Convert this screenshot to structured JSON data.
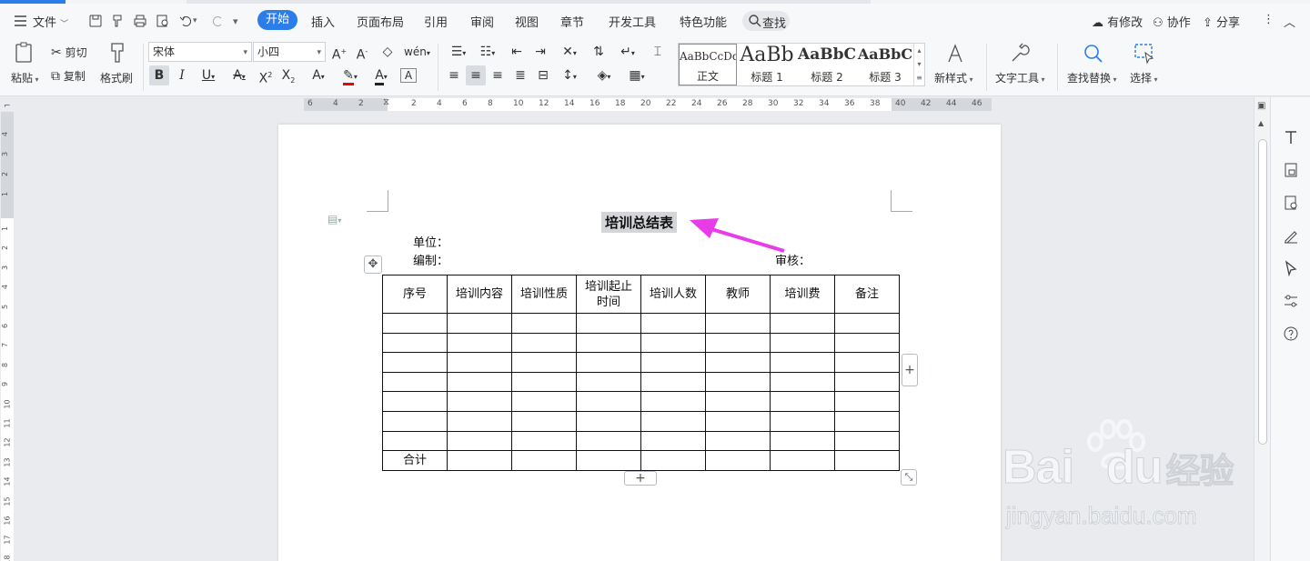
{
  "menu": {
    "file": "文件",
    "tabs": [
      "开始",
      "插入",
      "页面布局",
      "引用",
      "审阅",
      "视图",
      "章节",
      "开发工具",
      "特色功能"
    ],
    "search": "查找",
    "right": [
      "有修改",
      "协作",
      "分享"
    ]
  },
  "ribbon": {
    "paste": "粘贴",
    "cut": "剪切",
    "copy": "复制",
    "format_painter": "格式刷",
    "font_name": "宋体",
    "font_size": "小四",
    "styles": [
      {
        "sample": "AaBbCcDd",
        "name": "正文"
      },
      {
        "sample": "AaBb",
        "name": "标题 1"
      },
      {
        "sample": "AaBbC",
        "name": "标题 2"
      },
      {
        "sample": "AaBbC",
        "name": "标题 3"
      }
    ],
    "new_style": "新样式",
    "text_tools": "文字工具",
    "find_replace": "查找替换",
    "select": "选择"
  },
  "ruler": {
    "h_ticks": [
      "6",
      "4",
      "2",
      "2",
      "4",
      "6",
      "8",
      "10",
      "12",
      "14",
      "16",
      "18",
      "20",
      "22",
      "24",
      "26",
      "28",
      "30",
      "32",
      "34",
      "36",
      "38",
      "40",
      "42",
      "44",
      "46"
    ],
    "v_ticks_top": [
      "4",
      "3",
      "2",
      "1"
    ],
    "v_ticks": [
      "1",
      "2",
      "3",
      "4",
      "5",
      "6",
      "7",
      "8",
      "9",
      "10",
      "11",
      "12",
      "13",
      "14",
      "15",
      "16",
      "17",
      "18"
    ]
  },
  "document": {
    "title": "培训总结表",
    "unit_label": "单位：",
    "editor_label": "编制：",
    "reviewer_label": "审核：",
    "headers": [
      "序号",
      "培训内容",
      "培训性质",
      "培训起止时间",
      "培训人数",
      "教师",
      "培训费",
      "备注"
    ],
    "header_lines": [
      [
        "序号"
      ],
      [
        "培训内容"
      ],
      [
        "培训性质"
      ],
      [
        "培训起止",
        "时间"
      ],
      [
        "培训人数"
      ],
      [
        "教师"
      ],
      [
        "培训费"
      ],
      [
        "备注"
      ]
    ],
    "empty_rows": 7,
    "total_label": "合计"
  },
  "watermark": {
    "brand": "Bai",
    "brand2": "du",
    "cn": "经验",
    "url": "jingyan.baidu.com"
  },
  "colors": {
    "accent": "#2b7de9",
    "arrow": "#e83ce8"
  }
}
